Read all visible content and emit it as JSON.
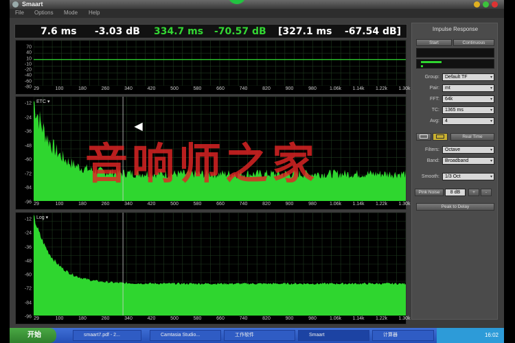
{
  "window": {
    "title": "Smaart"
  },
  "menu": [
    "File",
    "Options",
    "Mode",
    "Help"
  ],
  "readout": {
    "v1": "7.6 ms",
    "v2": "-3.03 dB",
    "v3": "334.7 ms",
    "v4": "-70.57 dB",
    "v5": "[327.1 ms",
    "v6": "-67.54 dB]",
    "colors": {
      "white": "#ffffff",
      "green": "#33d633"
    }
  },
  "plots": {
    "x_ticks": [
      "29",
      "100",
      "180",
      "260",
      "340",
      "420",
      "500",
      "580",
      "660",
      "740",
      "820",
      "900",
      "980",
      "1.06k",
      "1.14k",
      "1.22k",
      "1.30k"
    ],
    "top": {
      "y_ticks": [
        "70",
        "40",
        "10",
        "-10",
        "-20",
        "-40",
        "-60",
        "-80"
      ]
    },
    "etc": {
      "tag": "ETC ▾",
      "y_ticks": [
        "-12",
        "-24",
        "-36",
        "-48",
        "-60",
        "-72",
        "-84",
        "-96"
      ]
    },
    "log": {
      "tag": "Log ▾",
      "y_ticks": [
        "-12",
        "-24",
        "-36",
        "-48",
        "-60",
        "-72",
        "-84",
        "-96"
      ]
    },
    "trace_color": "#2fd62f"
  },
  "panel": {
    "title": "Impulse Response",
    "start": "Start",
    "continuous": "Continuous",
    "group_label": "Group:",
    "group_value": "Default TF",
    "pair_label": "Pair:",
    "pair_value": "mt",
    "fft_label": "FFT:",
    "fft_value": "64k",
    "tc_label": "TC:",
    "tc_value": "1365 ms",
    "avg_label": "Avg:",
    "avg_value": "4",
    "realtime": "Real Time",
    "filters_label": "Filters:",
    "filters_value": "Octave",
    "band_label": "Band:",
    "band_value": "Broadband",
    "smooth_label": "Smooth:",
    "smooth_value": "1/3 Oct",
    "pink_noise": "Pink Noise",
    "pink_value": "8 dB",
    "plus": "+",
    "minus": "-",
    "peak_to_delay": "Peak to Delay"
  },
  "watermark": "音响师之家",
  "taskbar": {
    "start": "开始",
    "tasks": [
      "smaart7.pdf - 2...",
      "Camtasia Studio...",
      "工作软件",
      "Smaart",
      "计算器"
    ],
    "clock": "16:02"
  }
}
